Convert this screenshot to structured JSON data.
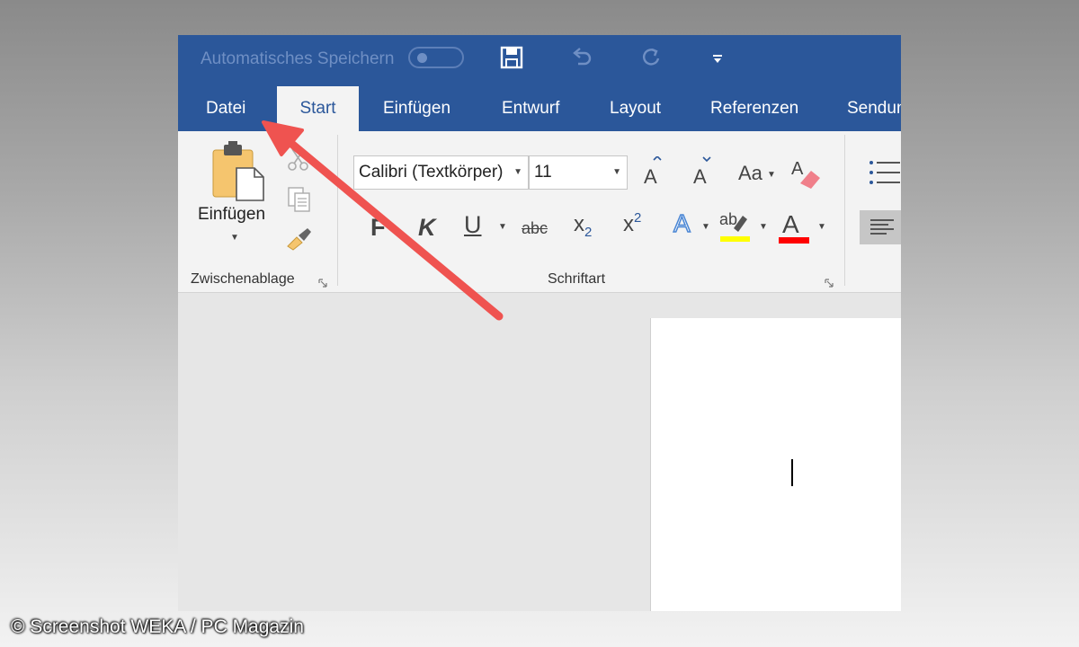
{
  "titlebar": {
    "autosave_label": "Automatisches Speichern",
    "autosave_state": "off"
  },
  "tabs": [
    {
      "label": "Datei",
      "active": false
    },
    {
      "label": "Start",
      "active": true
    },
    {
      "label": "Einfügen",
      "active": false
    },
    {
      "label": "Entwurf",
      "active": false
    },
    {
      "label": "Layout",
      "active": false
    },
    {
      "label": "Referenzen",
      "active": false
    },
    {
      "label": "Sendun",
      "active": false
    }
  ],
  "clipboard": {
    "paste_label": "Einfügen",
    "group_label": "Zwischenablage"
  },
  "font": {
    "family": "Calibri (Textkörper)",
    "size": "11",
    "case_label": "Aa",
    "group_label": "Schriftart",
    "bold_label": "F",
    "italic_label": "K",
    "underline_label": "U",
    "strike_label": "abc",
    "subscript_label": "x",
    "subscript_index": "2",
    "superscript_label": "x",
    "superscript_index": "2",
    "effects_label": "A",
    "highlight_label": "ab",
    "color_label": "A"
  },
  "colors": {
    "ribbon_blue": "#2b579a",
    "highlight": "#ffff00",
    "font_color": "#ff0000",
    "annotation_arrow": "#ef5350"
  },
  "watermark": "© Screenshot WEKA / PC Magazin"
}
